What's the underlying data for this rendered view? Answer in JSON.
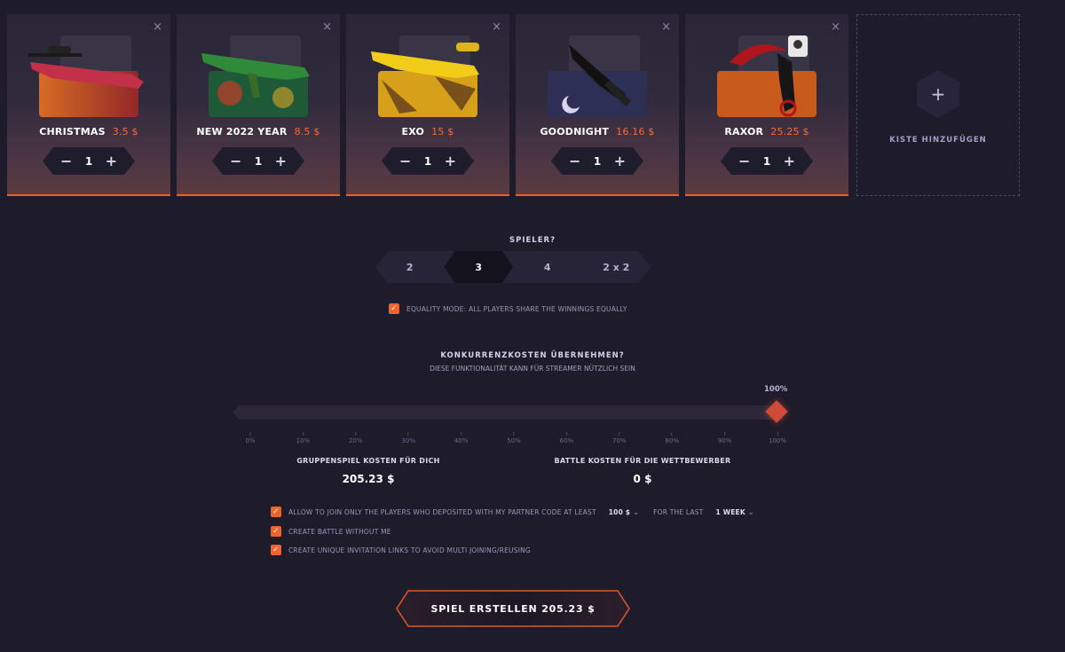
{
  "cases": [
    {
      "name": "CHRISTMAS",
      "price": "3.5 $",
      "quantity": "1",
      "close": "×",
      "minus": "−",
      "plus": "+",
      "art": "sniper-rifle",
      "accent": "#c9283a"
    },
    {
      "name": "NEW 2022 YEAR",
      "price": "8.5 $",
      "quantity": "1",
      "close": "×",
      "minus": "−",
      "plus": "+",
      "art": "assault-rifle",
      "accent": "#2f8a3a"
    },
    {
      "name": "EXO",
      "price": "15 $",
      "quantity": "1",
      "close": "×",
      "minus": "−",
      "plus": "+",
      "art": "gold-rifle",
      "accent": "#e8c21a"
    },
    {
      "name": "GOODNIGHT",
      "price": "16.16 $",
      "quantity": "1",
      "close": "×",
      "minus": "−",
      "plus": "+",
      "art": "knife",
      "accent": "#3a3f66"
    },
    {
      "name": "RAXOR",
      "price": "25.25 $",
      "quantity": "1",
      "close": "×",
      "minus": "−",
      "plus": "+",
      "art": "karambit",
      "accent": "#b0151c"
    }
  ],
  "add_case": {
    "icon": "+",
    "label": "KISTE HINZUFÜGEN"
  },
  "players": {
    "title": "SPIELER?",
    "options": [
      "2",
      "3",
      "4",
      "2 x 2"
    ],
    "selected": "3"
  },
  "equality": {
    "checked": true,
    "check": "✓",
    "label": "EQUALITY MODE: ALL PLAYERS SHARE THE WINNINGS EQUALLY"
  },
  "coverage": {
    "title": "KONKURRENZKOSTEN ÜBERNEHMEN?",
    "subtitle": "DIESE FUNKTIONALITÄT KANN FÜR STREAMER NÜTZLICH SEIN",
    "value_label": "100%",
    "value": 100,
    "ticks": [
      "0%",
      "10%",
      "20%",
      "30%",
      "40%",
      "50%",
      "60%",
      "70%",
      "80%",
      "90%",
      "100%"
    ]
  },
  "costs": {
    "you_label": "GRUPPENSPIEL KOSTEN FÜR DICH",
    "you_value": "205.23 $",
    "others_label": "BATTLE KOSTEN FÜR DIE WETTBEWERBER",
    "others_value": "0 $"
  },
  "options": {
    "partner_label": "ALLOW TO JOIN ONLY THE PLAYERS WHO DEPOSITED WITH MY PARTNER CODE AT LEAST",
    "partner_amount": "100 $",
    "for_the_last": "FOR THE LAST",
    "period": "1 WEEK",
    "without_me": "CREATE BATTLE WITHOUT ME",
    "unique_links": "CREATE UNIQUE INVITATION LINKS TO AVOID MULTI JOINING/REUSING",
    "check": "✓",
    "caret": "⌄"
  },
  "create_button": "SPIEL ERSTELLEN 205.23 $",
  "colors": {
    "accent": "#f0632f",
    "background": "#1e1b2b"
  }
}
